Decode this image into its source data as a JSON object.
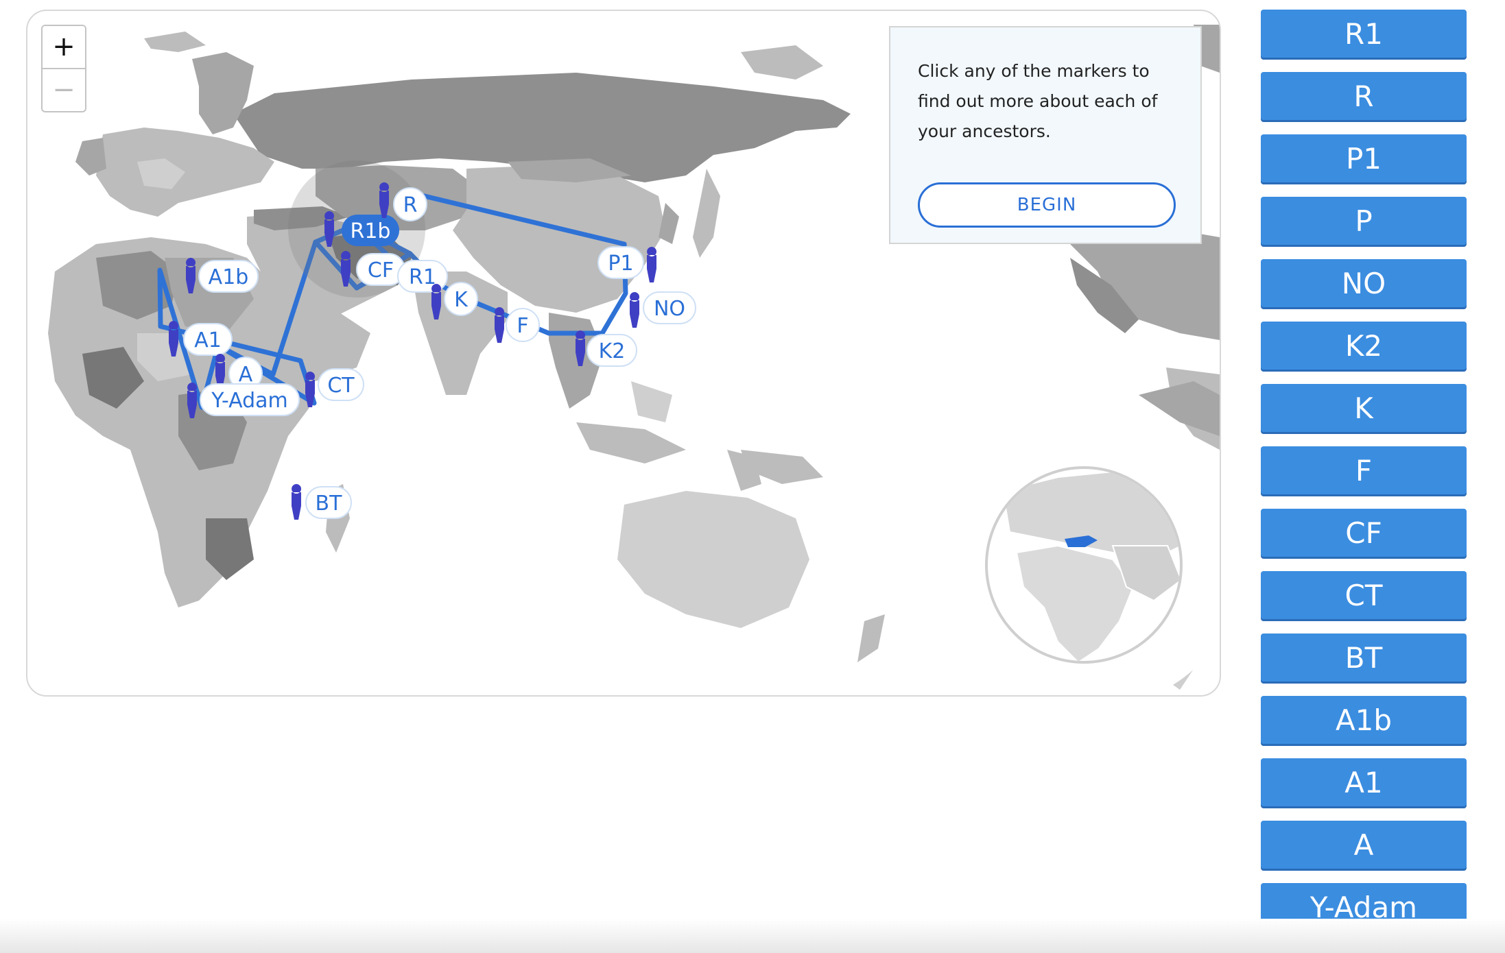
{
  "zoom": {
    "in_label": "+",
    "out_label": "−"
  },
  "info": {
    "text": "Click any of the markers to find out more about each of your ancestors.",
    "begin_label": "BEGIN"
  },
  "colors": {
    "route": "#2f72d6",
    "marker_person": "#3f3fc4",
    "accent": "#2a6fd6",
    "button_bg": "#3b8de0",
    "highlight_country": "#2a6fd6"
  },
  "markers": [
    {
      "id": "R",
      "label": "R"
    },
    {
      "id": "R1b",
      "label": "R1b",
      "selected": true
    },
    {
      "id": "CF",
      "label": "CF"
    },
    {
      "id": "R1",
      "label": "R1"
    },
    {
      "id": "K",
      "label": "K"
    },
    {
      "id": "F",
      "label": "F"
    },
    {
      "id": "P1",
      "label": "P1"
    },
    {
      "id": "NO",
      "label": "NO"
    },
    {
      "id": "K2",
      "label": "K2"
    },
    {
      "id": "A1b",
      "label": "A1b"
    },
    {
      "id": "A1",
      "label": "A1"
    },
    {
      "id": "A",
      "label": "A"
    },
    {
      "id": "Y-Adam",
      "label": "Y-Adam"
    },
    {
      "id": "CT",
      "label": "CT"
    },
    {
      "id": "BT",
      "label": "BT"
    }
  ],
  "haplogroup_buttons": [
    "R1",
    "R",
    "P1",
    "P",
    "NO",
    "K2",
    "K",
    "F",
    "CF",
    "CT",
    "BT",
    "A1b",
    "A1",
    "A",
    "Y-Adam"
  ],
  "minimap": {
    "highlight": "Turkey"
  }
}
